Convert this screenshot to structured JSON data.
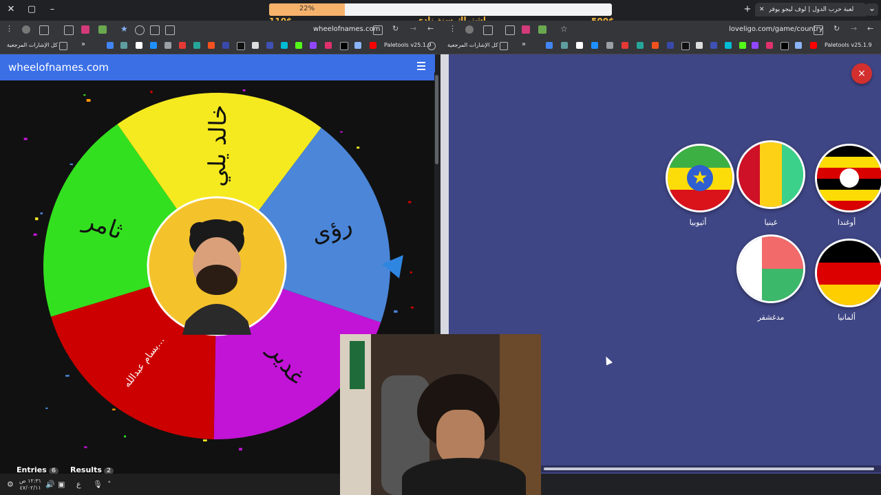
{
  "stream_overlay": {
    "progress_percent": 22,
    "progress_label": "22%",
    "goal_left": "110$",
    "goal_right": "500$",
    "title": "اشتراك سنة نادي عشان أعضل"
  },
  "browser_left": {
    "address": "wheelofnames.com",
    "bookmarks_folder": "كل الإشارات المرجعية",
    "extension_label": "Paletools v25.1.9"
  },
  "browser_right": {
    "tab_title": "لعبة حرب الدول | لوف ليجو يوفر",
    "address": "loveligo.com/game/country",
    "bookmarks_folder": "كل الإشارات المرجعية",
    "extension_label": "Paletools v25.1.9"
  },
  "wheel": {
    "site_title": "wheelofnames.com",
    "entries_label": "Entries",
    "entries_count": "6",
    "results_label": "Results",
    "results_count": "2",
    "segments": [
      {
        "label": "خالد يلي",
        "color": "#f4ea1f"
      },
      {
        "label": "رؤى",
        "color": "#4b86d8"
      },
      {
        "label": "غدير",
        "color": "#c214d6"
      },
      {
        "label": "بسام عبدالله…",
        "color": "#cc0000"
      },
      {
        "label": "ثامر",
        "color": "#33e01f"
      }
    ]
  },
  "country_game": {
    "close_label": "×",
    "countries": [
      {
        "name": "أوغندا",
        "flag": "uganda-flag"
      },
      {
        "name": "غينيا",
        "flag": "guinea-flag"
      },
      {
        "name": "أثيوبيا",
        "flag": "ethiopia-flag"
      },
      {
        "name": "ألمانيا",
        "flag": "germany-flag"
      },
      {
        "name": "مدغشقر",
        "flag": "madagascar-flag"
      }
    ]
  },
  "taskbar": {
    "time": "١٢:٣١ ص",
    "date": "٤٧/٠٢/١١",
    "language": "ع"
  }
}
